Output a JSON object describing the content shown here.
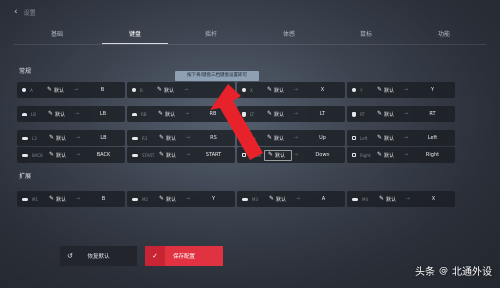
{
  "window": {
    "back_glyph": "‹",
    "title": "设置"
  },
  "tabs": [
    {
      "label": "基础"
    },
    {
      "label": "键盘"
    },
    {
      "label": "摇杆"
    },
    {
      "label": "体感"
    },
    {
      "label": "鼠标"
    },
    {
      "label": "功能"
    }
  ],
  "sections": {
    "general": "常规",
    "extended": "扩展"
  },
  "tooltip": "按下将/键盘三档键盘设置即可",
  "common": {
    "default_label": "默认",
    "arrow": "→"
  },
  "grid": [
    [
      {
        "icon": "a-button-icon",
        "name": "A",
        "value": "B"
      },
      {
        "icon": "b-button-icon",
        "name": "B",
        "value": ""
      },
      {
        "icon": "x-button-icon",
        "name": "X",
        "value": "X"
      },
      {
        "icon": "y-button-icon",
        "name": "Y",
        "value": "Y"
      }
    ],
    [
      {
        "icon": "lb-bumper-icon",
        "name": "LB",
        "value": "LB"
      },
      {
        "icon": "rb-bumper-icon",
        "name": "RB",
        "value": "RB"
      },
      {
        "icon": "lt-trigger-icon",
        "name": "LT",
        "value": "LT"
      },
      {
        "icon": "rt-trigger-icon",
        "name": "RT",
        "value": "RT"
      }
    ],
    [
      {
        "icon": "l3-stick-icon",
        "name": "L3",
        "value": "LB"
      },
      {
        "icon": "r3-stick-icon",
        "name": "R3",
        "value": "RS"
      },
      {
        "icon": "dpad-up-icon",
        "name": "Up",
        "value": "Up"
      },
      {
        "icon": "dpad-left-icon",
        "name": "Left",
        "value": "Left"
      }
    ],
    [
      {
        "icon": "back-button-icon",
        "name": "BACK",
        "value": "BACK"
      },
      {
        "icon": "start-button-icon",
        "name": "START",
        "value": "START"
      },
      {
        "icon": "dpad-down-icon",
        "name": "Down",
        "value": "Down"
      },
      {
        "icon": "dpad-right-icon",
        "name": "Right",
        "value": "Right"
      }
    ]
  ],
  "extended": [
    {
      "icon": "m1-button-icon",
      "name": "M1",
      "value": "B"
    },
    {
      "icon": "m2-button-icon",
      "name": "M2",
      "value": "Y"
    },
    {
      "icon": "m3-button-icon",
      "name": "M3",
      "value": "A"
    },
    {
      "icon": "m4-button-icon",
      "name": "M4",
      "value": "X"
    }
  ],
  "buttons": {
    "reset_icon": "↺",
    "reset_label": "恢复默认",
    "save_icon": "✓",
    "save_label": "保存配置"
  },
  "watermark": {
    "brand": "头条",
    "sep": "@",
    "author": "北通外设"
  },
  "colors": {
    "save_red": "#e03241",
    "tooltip_bg": "#8ea1b4",
    "arrow_red": "#e8222b"
  }
}
